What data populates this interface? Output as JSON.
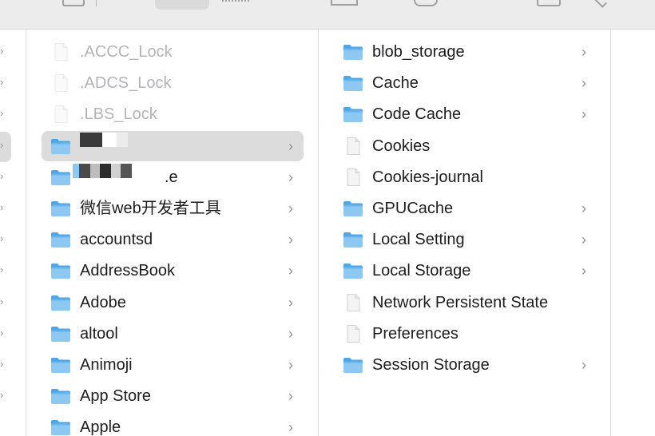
{
  "toolbar": {
    "icons": [
      "view-grid-icon",
      "view-columns-icon",
      "view-list-icon",
      "gallery-icon",
      "share-icon",
      "group-icon",
      "tag-icon"
    ]
  },
  "column1": {
    "chevrons": 12
  },
  "column2": {
    "items": [
      {
        "label": ".ACCC_Lock",
        "kind": "file",
        "dimmed": true,
        "has_children": false
      },
      {
        "label": ".ADCS_Lock",
        "kind": "file",
        "dimmed": true,
        "has_children": false
      },
      {
        "label": ".LBS_Lock",
        "kind": "file",
        "dimmed": true,
        "has_children": false
      },
      {
        "label": "",
        "kind": "folder",
        "dimmed": false,
        "has_children": true,
        "selected": true,
        "redacted": true
      },
      {
        "label": ".e",
        "kind": "folder",
        "dimmed": false,
        "has_children": true,
        "redacted": true
      },
      {
        "label": "微信web开发者工具",
        "kind": "folder",
        "dimmed": false,
        "has_children": true
      },
      {
        "label": "accountsd",
        "kind": "folder",
        "dimmed": false,
        "has_children": true
      },
      {
        "label": "AddressBook",
        "kind": "folder",
        "dimmed": false,
        "has_children": true
      },
      {
        "label": "Adobe",
        "kind": "folder",
        "dimmed": false,
        "has_children": true
      },
      {
        "label": "altool",
        "kind": "folder",
        "dimmed": false,
        "has_children": true
      },
      {
        "label": "Animoji",
        "kind": "folder",
        "dimmed": false,
        "has_children": true
      },
      {
        "label": "App Store",
        "kind": "folder",
        "dimmed": false,
        "has_children": true
      },
      {
        "label": "Apple",
        "kind": "folder",
        "dimmed": false,
        "has_children": true
      }
    ]
  },
  "column3": {
    "items": [
      {
        "label": "blob_storage",
        "kind": "folder",
        "has_children": true
      },
      {
        "label": "Cache",
        "kind": "folder",
        "has_children": true
      },
      {
        "label": "Code Cache",
        "kind": "folder",
        "has_children": true
      },
      {
        "label": "Cookies",
        "kind": "file",
        "has_children": false
      },
      {
        "label": "Cookies-journal",
        "kind": "file",
        "has_children": false
      },
      {
        "label": "GPUCache",
        "kind": "folder",
        "has_children": true
      },
      {
        "label": "Local Setting",
        "kind": "folder",
        "has_children": true
      },
      {
        "label": "Local Storage",
        "kind": "folder",
        "has_children": true
      },
      {
        "label": "Network Persistent State",
        "kind": "file",
        "has_children": false
      },
      {
        "label": "Preferences",
        "kind": "file",
        "has_children": false
      },
      {
        "label": "Session Storage",
        "kind": "folder",
        "has_children": true
      }
    ]
  },
  "colors": {
    "folder_light": "#8cc8f2",
    "folder_dark": "#4ea6e6",
    "selection": "#dcdcdc",
    "chevron": "#8e8e93",
    "dimmed_text": "#b4b4b8"
  }
}
